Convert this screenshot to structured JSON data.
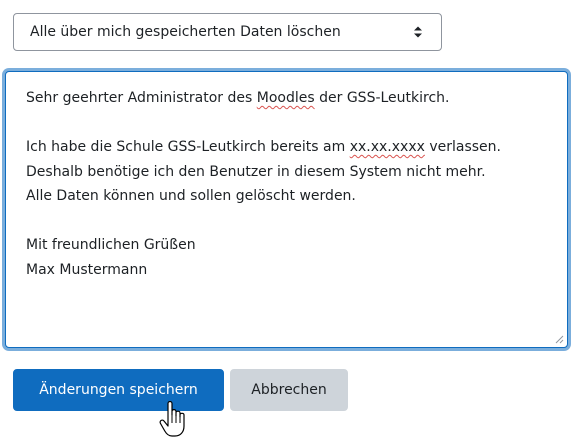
{
  "select": {
    "value": "Alle über mich gespeicherten Daten löschen",
    "icon": "sort-arrows-icon"
  },
  "message": {
    "lines": [
      {
        "before": "Sehr geehrter Administrator des ",
        "spell": "Moodles",
        "after": " der GSS-Leutkirch."
      },
      {
        "before": "",
        "spell": "",
        "after": ""
      },
      {
        "before": "Ich habe die Schule GSS-Leutkirch bereits am ",
        "spell": "xx.xx.xxxx",
        "after": " verlassen."
      },
      {
        "before": "Deshalb benötige ich den Benutzer in diesem System nicht mehr.",
        "spell": "",
        "after": ""
      },
      {
        "before": "Alle Daten können und sollen gelöscht werden.",
        "spell": "",
        "after": ""
      },
      {
        "before": "",
        "spell": "",
        "after": ""
      },
      {
        "before": "Mit freundlichen Grüßen",
        "spell": "",
        "after": ""
      },
      {
        "before": "Max Mustermann",
        "spell": "",
        "after": ""
      }
    ]
  },
  "buttons": {
    "save_label": "Änderungen speichern",
    "cancel_label": "Abbrechen"
  },
  "colors": {
    "primary": "#0f6cbf",
    "secondary": "#ced4da",
    "text": "#1d2125",
    "spellcheck": "#d9534f"
  }
}
